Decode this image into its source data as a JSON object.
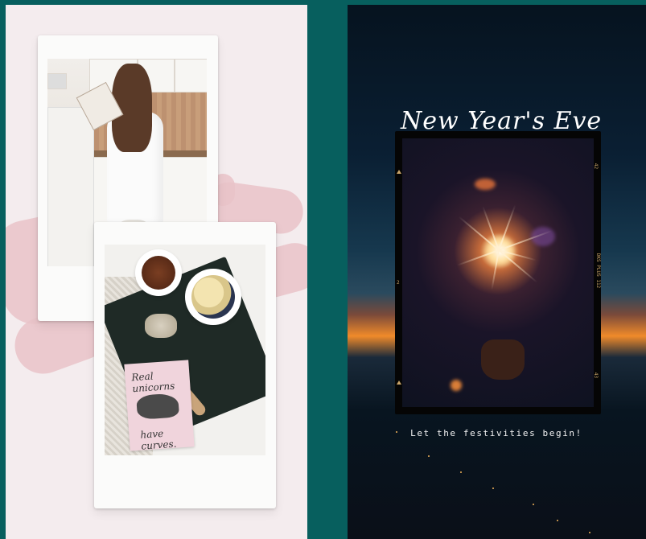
{
  "left_post": {
    "card_text_line1": "Real unicorns",
    "card_text_line2": "have curves."
  },
  "right_post": {
    "headline": "New Year's Eve",
    "subline": "Let the festivities begin!",
    "film_marks": {
      "top": "42",
      "middle": "DKS PLUS 112",
      "side_left": "2",
      "bottom": "43"
    }
  },
  "colors": {
    "background": "#075f5e",
    "left_card": "#f4ecee",
    "brush_stroke": "#e9c3c8",
    "film_frame": "#050505"
  }
}
